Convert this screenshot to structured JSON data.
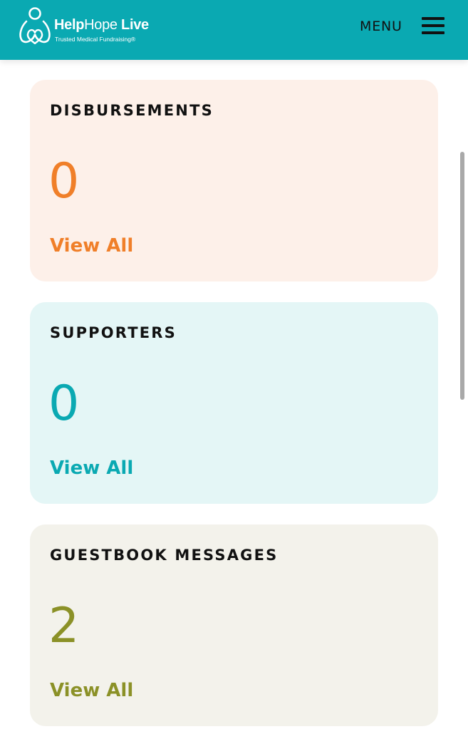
{
  "header": {
    "logo_part1": "Help",
    "logo_part2": "Hope",
    "logo_part3": "Live",
    "logo_tagline": "Trusted Medical Fundraising®",
    "menu_label": "MENU",
    "background_color": "#0aa9b2"
  },
  "cards": [
    {
      "title": "DISBURSEMENTS",
      "count": "0",
      "link_label": "View All",
      "background_color": "#fdf0e9",
      "accent_color": "#f07f29"
    },
    {
      "title": "SUPPORTERS",
      "count": "0",
      "link_label": "View All",
      "background_color": "#e4f6f6",
      "accent_color": "#0aa9b2"
    },
    {
      "title": "GUESTBOOK MESSAGES",
      "count": "2",
      "link_label": "View All",
      "background_color": "#f3f2eb",
      "accent_color": "#8b9127"
    }
  ]
}
